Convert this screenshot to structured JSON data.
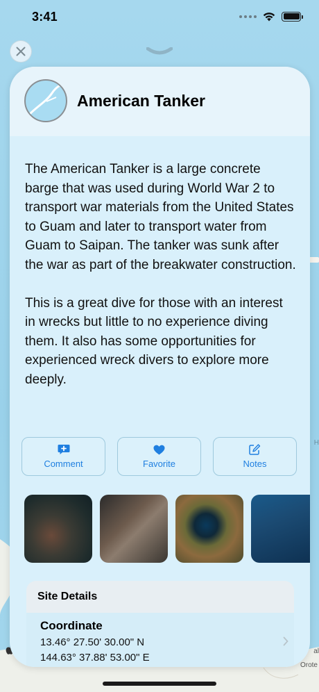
{
  "status": {
    "time": "3:41"
  },
  "site": {
    "title": "American Tanker",
    "description": [
      "The American Tanker is a large concrete barge that was used during World War 2 to transport war materials from the United States to Guam and later to transport water from Guam to Saipan. The tanker was sunk after the war as part of the breakwater construction.",
      "This is a great dive for those with an interest in wrecks but little to no experience diving them.  It also has some opportunities for experienced wreck divers to explore more deeply."
    ]
  },
  "actions": {
    "comment_label": "Comment",
    "favorite_label": "Favorite",
    "notes_label": "Notes"
  },
  "details": {
    "section_title": "Site Details",
    "coordinate_title": "Coordinate",
    "coordinate_lat": "13.46° 27.50' 30.00\" N",
    "coordinate_lon": "144.63° 37.88' 53.00\" E"
  },
  "map": {
    "label_h": "H",
    "label_right_1": "al",
    "label_right_2": "Orote"
  },
  "colors": {
    "accent": "#1f7fe0",
    "sheet": "#d9f0fb",
    "water": "#9fd3ea"
  }
}
